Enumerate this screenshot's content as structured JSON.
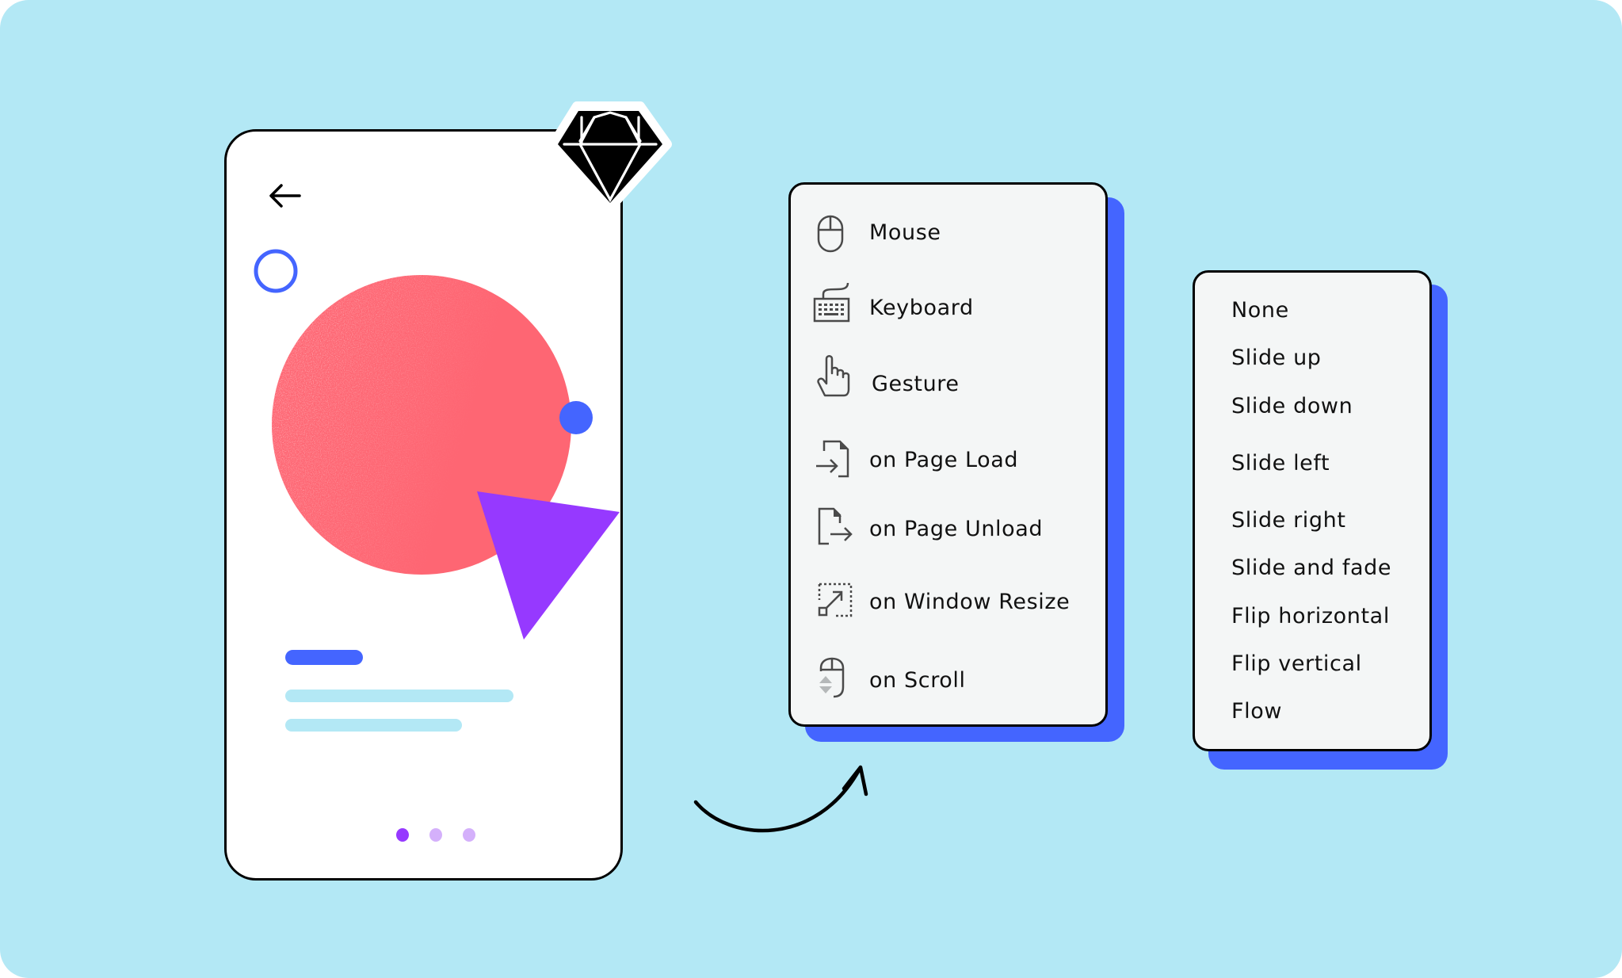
{
  "colors": {
    "background": "#b3e8f5",
    "accent_blue": "#4465ff",
    "coral": "#fe6673",
    "purple": "#9639ff",
    "light_purple": "#d4b0fb",
    "light_bar": "#b3e8f5",
    "menu_bg": "#f4f6f6",
    "icon_gray": "#4a4a4a"
  },
  "phone": {
    "back_icon": "arrow-left-icon",
    "pagination": {
      "count": 3,
      "active_index": 0
    }
  },
  "logo": {
    "icon": "sketch-diamond-icon"
  },
  "trigger_menu": {
    "items": [
      {
        "label": "Mouse",
        "icon": "mouse-icon"
      },
      {
        "label": "Keyboard",
        "icon": "keyboard-icon"
      },
      {
        "label": "Gesture",
        "icon": "hand-pointer-icon"
      },
      {
        "label": "on Page Load",
        "icon": "page-load-icon"
      },
      {
        "label": "on Page Unload",
        "icon": "page-unload-icon"
      },
      {
        "label": "on Window Resize",
        "icon": "window-resize-icon"
      },
      {
        "label": "on Scroll",
        "icon": "mouse-scroll-icon"
      }
    ]
  },
  "animation_menu": {
    "items": [
      {
        "label": "None"
      },
      {
        "label": "Slide up"
      },
      {
        "label": "Slide down"
      },
      {
        "label": "Slide left"
      },
      {
        "label": "Slide right"
      },
      {
        "label": "Slide and fade"
      },
      {
        "label": "Flip horizontal"
      },
      {
        "label": "Flip vertical"
      },
      {
        "label": "Flow"
      }
    ]
  }
}
